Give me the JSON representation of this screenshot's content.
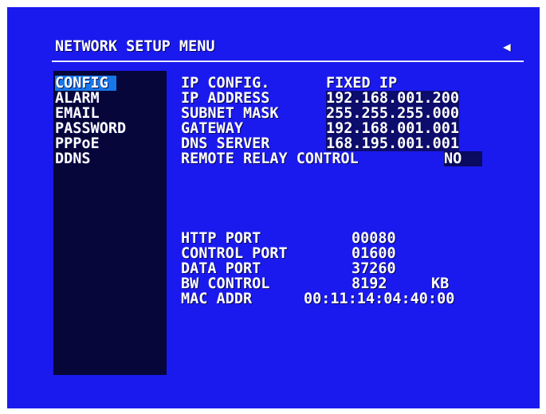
{
  "menu": {
    "title": "NETWORK SETUP MENU",
    "back_icon": "left-triangle-icon",
    "items": [
      {
        "label": "CONFIG",
        "selected": true
      },
      {
        "label": "ALARM",
        "selected": false
      },
      {
        "label": "EMAIL",
        "selected": false
      },
      {
        "label": "PASSWORD",
        "selected": false
      },
      {
        "label": "PPPoE",
        "selected": false
      },
      {
        "label": "DDNS",
        "selected": false
      }
    ]
  },
  "config": {
    "ip_config_label": "IP CONFIG.",
    "ip_config_value": "FIXED IP",
    "ip_address_label": "IP ADDRESS",
    "ip_address_value": "192.168.001.200",
    "subnet_mask_label": "SUBNET MASK",
    "subnet_mask_value": "255.255.255.000",
    "gateway_label": "GATEWAY",
    "gateway_value": "192.168.001.001",
    "dns_server_label": "DNS SERVER",
    "dns_server_value": "168.195.001.001",
    "remote_relay_label": "REMOTE RELAY CONTROL",
    "remote_relay_value": "NO"
  },
  "ports": {
    "http_port_label": "HTTP PORT",
    "http_port_value": "00080",
    "control_port_label": "CONTROL PORT",
    "control_port_value": "01600",
    "data_port_label": "DATA PORT",
    "data_port_value": "37260",
    "bw_control_label": "BW CONTROL",
    "bw_control_value": "8192",
    "bw_control_unit": "KB",
    "mac_addr_label": "MAC ADDR",
    "mac_addr_value": "00:11:14:04:40:00"
  },
  "colors": {
    "screen_bg": "#1a1aee",
    "sidebar_bg": "#06063a",
    "selection_bg": "#1677e8",
    "text": "#ffffff"
  }
}
